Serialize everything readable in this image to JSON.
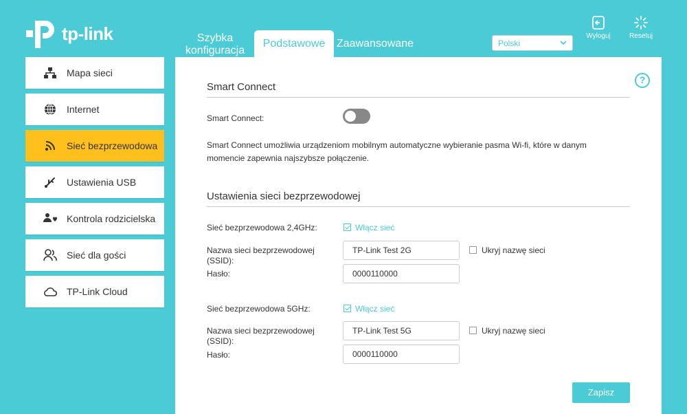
{
  "header": {
    "brand": "tp-link",
    "tabs": [
      {
        "label_line1": "Szybka",
        "label_line2": "konfiguracja"
      },
      {
        "label": "Podstawowe"
      },
      {
        "label": "Zaawansowane"
      }
    ],
    "language": "Polski",
    "logout_label": "Wyloguj",
    "reset_label": "Resetuj"
  },
  "sidebar": {
    "items": [
      {
        "label": "Mapa sieci",
        "icon": "network-map-icon"
      },
      {
        "label": "Internet",
        "icon": "globe-icon"
      },
      {
        "label": "Sieć bezprzewodowa",
        "icon": "wifi-icon",
        "active": true
      },
      {
        "label": "Ustawienia USB",
        "icon": "usb-icon"
      },
      {
        "label": "Kontrola rodzicielska",
        "icon": "parental-icon"
      },
      {
        "label": "Sieć dla gości",
        "icon": "guest-icon"
      },
      {
        "label": "TP-Link Cloud",
        "icon": "cloud-icon"
      }
    ]
  },
  "smart_connect": {
    "title": "Smart Connect",
    "label": "Smart Connect:",
    "enabled": false,
    "description_line1": "Smart Connect umożliwia urządzeniom mobilnym automatyczne wybieranie pasma Wi-fi, które w danym",
    "description_line2": "momencie zapewnia najszybsze połączenie."
  },
  "wireless": {
    "title": "Ustawienia sieci bezprzewodowej",
    "band24": {
      "label": "Sieć bezprzewodowa 2,4GHz:",
      "enable_label": "Włącz sieć",
      "enabled": true,
      "ssid_label_line1": "Nazwa sieci bezprzewodowej",
      "ssid_label_line2": "(SSID):",
      "ssid": "TP-Link Test 2G",
      "hide_label": "Ukryj nazwę sieci",
      "password_label": "Hasło:",
      "password": "0000110000"
    },
    "band5": {
      "label": "Sieć bezprzewodowa 5GHz:",
      "enable_label": "Włącz sieć",
      "enabled": true,
      "ssid_label_line1": "Nazwa sieci bezprzewodowej",
      "ssid_label_line2": "(SSID):",
      "ssid": "TP-Link Test 5G",
      "hide_label": "Ukryj nazwę sieci",
      "password_label": "Hasło:",
      "password": "0000110000"
    }
  },
  "save_label": "Zapisz",
  "help_symbol": "?",
  "colors": {
    "accent": "#4acbd6",
    "active_item": "#ffc01e",
    "panel": "#ffffff"
  }
}
